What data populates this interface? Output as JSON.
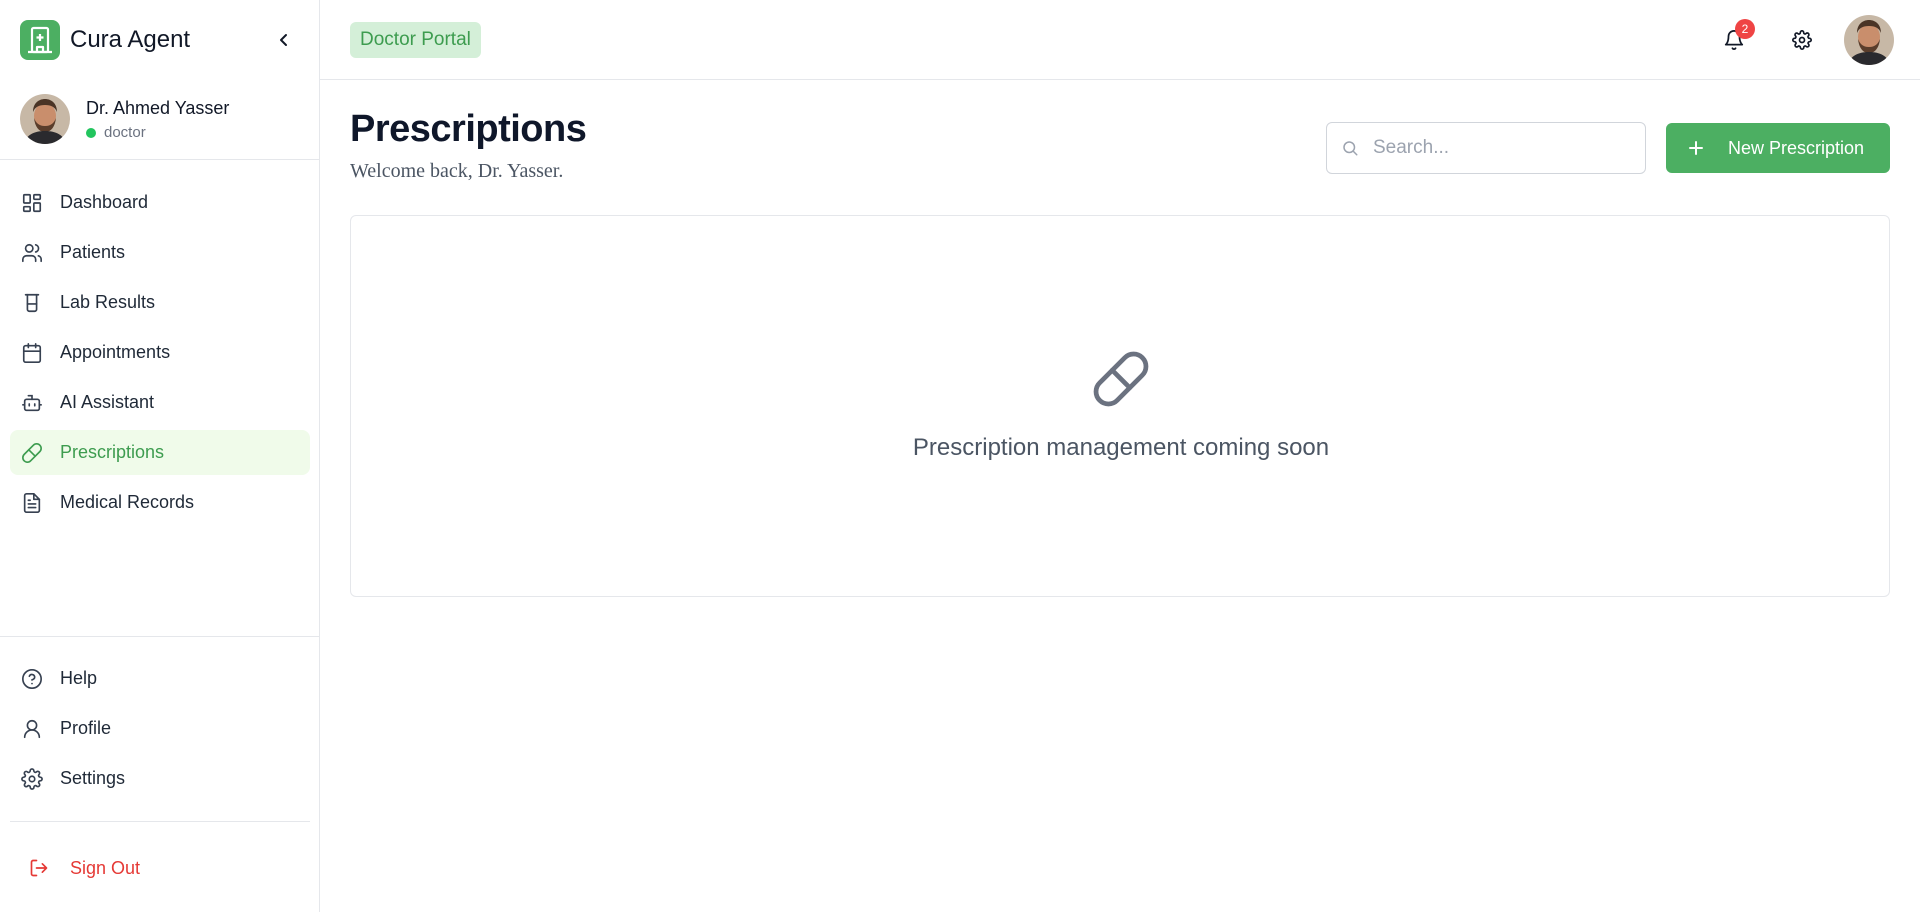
{
  "app": {
    "name": "Cura Agent",
    "accent": "#4caf62"
  },
  "user": {
    "name": "Dr. Ahmed Yasser",
    "role": "doctor",
    "status_color": "#22c55e"
  },
  "sidebar": {
    "items": [
      {
        "label": "Dashboard",
        "icon": "dashboard-icon"
      },
      {
        "label": "Patients",
        "icon": "users-icon"
      },
      {
        "label": "Lab Results",
        "icon": "beaker-icon"
      },
      {
        "label": "Appointments",
        "icon": "calendar-icon"
      },
      {
        "label": "AI Assistant",
        "icon": "bot-icon"
      },
      {
        "label": "Prescriptions",
        "icon": "pill-icon",
        "active": true
      },
      {
        "label": "Medical Records",
        "icon": "document-icon"
      }
    ],
    "bottom_items": [
      {
        "label": "Help",
        "icon": "help-icon"
      },
      {
        "label": "Profile",
        "icon": "user-icon"
      },
      {
        "label": "Settings",
        "icon": "gear-icon"
      }
    ],
    "sign_out": "Sign Out"
  },
  "topbar": {
    "portal_badge": "Doctor Portal",
    "notification_count": "2"
  },
  "main": {
    "title": "Prescriptions",
    "subtitle": "Welcome back, Dr. Yasser.",
    "search_placeholder": "Search...",
    "new_button": "New Prescription",
    "empty_message": "Prescription management coming soon"
  }
}
